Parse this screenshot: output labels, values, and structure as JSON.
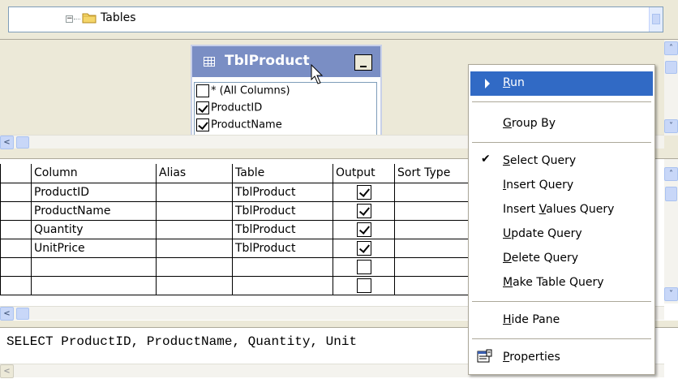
{
  "tree": {
    "label": "Tables",
    "expander": "−"
  },
  "diagram": {
    "table_title": "TblProduct",
    "columns": [
      {
        "label": "* (All Columns)",
        "checked": false
      },
      {
        "label": "ProductID",
        "checked": true
      },
      {
        "label": "ProductName",
        "checked": true
      }
    ]
  },
  "grid": {
    "headers": [
      "",
      "Column",
      "Alias",
      "Table",
      "Output",
      "Sort Type"
    ],
    "rows": [
      {
        "column": "ProductID",
        "alias": "",
        "table": "TblProduct",
        "output": true
      },
      {
        "column": "ProductName",
        "alias": "",
        "table": "TblProduct",
        "output": true
      },
      {
        "column": "Quantity",
        "alias": "",
        "table": "TblProduct",
        "output": true
      },
      {
        "column": "UnitPrice",
        "alias": "",
        "table": "TblProduct",
        "output": true
      },
      {
        "column": "",
        "alias": "",
        "table": "",
        "output": false
      },
      {
        "column": "",
        "alias": "",
        "table": "",
        "output": false
      }
    ]
  },
  "sql": {
    "text": "SELECT ProductID, ProductName, Quantity, Unit"
  },
  "context_menu": {
    "items": [
      {
        "key": "run",
        "pre": "",
        "u": "R",
        "post": "un",
        "selected": true
      },
      {
        "key": "group-by",
        "pre": "",
        "u": "G",
        "post": "roup By"
      },
      {
        "key": "select-query",
        "pre": "",
        "u": "S",
        "post": "elect Query",
        "checked": true
      },
      {
        "key": "insert-query",
        "pre": "",
        "u": "I",
        "post": "nsert Query"
      },
      {
        "key": "insert-values-query",
        "pre": "Insert ",
        "u": "V",
        "post": "alues Query"
      },
      {
        "key": "update-query",
        "pre": "",
        "u": "U",
        "post": "pdate Query"
      },
      {
        "key": "delete-query",
        "pre": "",
        "u": "D",
        "post": "elete Query"
      },
      {
        "key": "make-table-query",
        "pre": "",
        "u": "M",
        "post": "ake Table Query"
      },
      {
        "key": "hide-pane",
        "pre": "",
        "u": "H",
        "post": "ide Pane"
      },
      {
        "key": "properties",
        "pre": "",
        "u": "P",
        "post": "roperties"
      }
    ],
    "check_mark": "✔"
  },
  "icons": {
    "folder": "folder-icon",
    "table": "table-grid-icon",
    "properties": "properties-icon",
    "submenu_arrow": "arrow-right-icon"
  },
  "colors": {
    "selection": "#316ac5",
    "title_bar": "#7a8ec4",
    "background": "#ece9d8"
  }
}
